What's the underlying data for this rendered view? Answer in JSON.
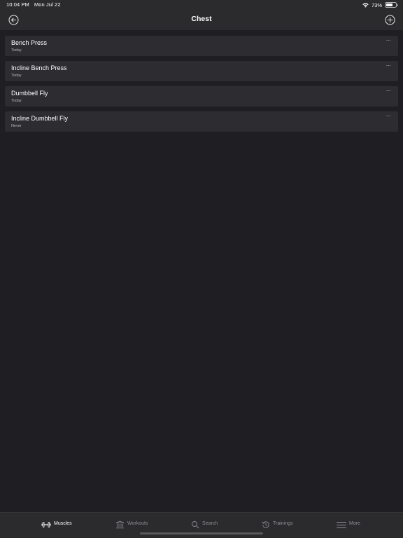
{
  "status_bar": {
    "time": "10:04 PM",
    "date": "Mon Jul 22",
    "battery_percent": "73%",
    "battery_level": 0.73
  },
  "nav": {
    "title": "Chest",
    "back_icon": "circle-arrow-left-icon",
    "add_icon": "circle-plus-icon"
  },
  "exercises": [
    {
      "name": "Bench Press",
      "last": "Today",
      "more": "···"
    },
    {
      "name": "Incline Bench Press",
      "last": "Today",
      "more": "···"
    },
    {
      "name": "Dumbbell Fly",
      "last": "Today",
      "more": "···"
    },
    {
      "name": "Incline Dumbbell Fly",
      "last": "Never",
      "more": "···"
    }
  ],
  "tabs": [
    {
      "label": "Muscles",
      "icon": "dumbbell-icon",
      "active": true
    },
    {
      "label": "Workouts",
      "icon": "building-columns-icon",
      "active": false
    },
    {
      "label": "Search",
      "icon": "search-icon",
      "active": false
    },
    {
      "label": "Trainings",
      "icon": "history-clock-icon",
      "active": false
    },
    {
      "label": "More",
      "icon": "menu-lines-icon",
      "active": false
    }
  ],
  "colors": {
    "background": "#1f1e22",
    "bar": "#2b2b2e",
    "row": "#2d2c31",
    "tab_inactive": "#8e8e93",
    "tab_active": "#ffffff"
  }
}
